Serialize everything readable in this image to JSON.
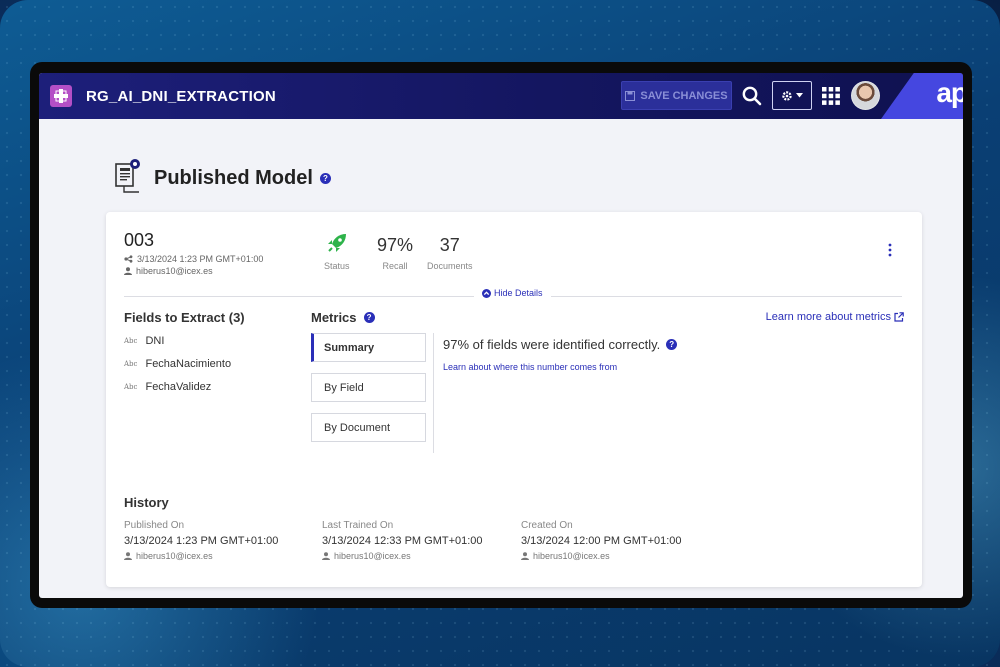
{
  "app": {
    "title": "RG_AI_DNI_EXTRACTION",
    "brand": "ap",
    "save_label": "SAVE CHANGES"
  },
  "page": {
    "title": "Published Model"
  },
  "model": {
    "version": "003",
    "published": "3/13/2024 1:23 PM GMT+01:00",
    "user": "hiberus10@icex.es",
    "stats": [
      {
        "value": "",
        "label": "Status"
      },
      {
        "value": "97%",
        "label": "Recall"
      },
      {
        "value": "37",
        "label": "Documents"
      }
    ],
    "hide_details": "Hide Details"
  },
  "fields": {
    "heading": "Fields to Extract (3)",
    "type_label": "Abc",
    "items": [
      "DNI",
      "FechaNacimiento",
      "FechaValidez"
    ]
  },
  "metrics": {
    "heading": "Metrics",
    "learn_more": "Learn more about metrics",
    "tabs": [
      "Summary",
      "By Field",
      "By Document"
    ],
    "result": "97% of fields were identified correctly.",
    "result_link": "Learn about where this number comes from"
  },
  "history": {
    "heading": "History",
    "columns": [
      {
        "label": "Published On",
        "value": "3/13/2024 1:23 PM GMT+01:00",
        "user": "hiberus10@icex.es"
      },
      {
        "label": "Last Trained On",
        "value": "3/13/2024 12:33 PM GMT+01:00",
        "user": "hiberus10@icex.es"
      },
      {
        "label": "Created On",
        "value": "3/13/2024 12:00 PM GMT+01:00",
        "user": "hiberus10@icex.es"
      }
    ]
  },
  "colors": {
    "accent": "#2a2fb8",
    "topbar": "#141660",
    "status_green": "#2db34a",
    "app_icon": "#b44fc6"
  }
}
